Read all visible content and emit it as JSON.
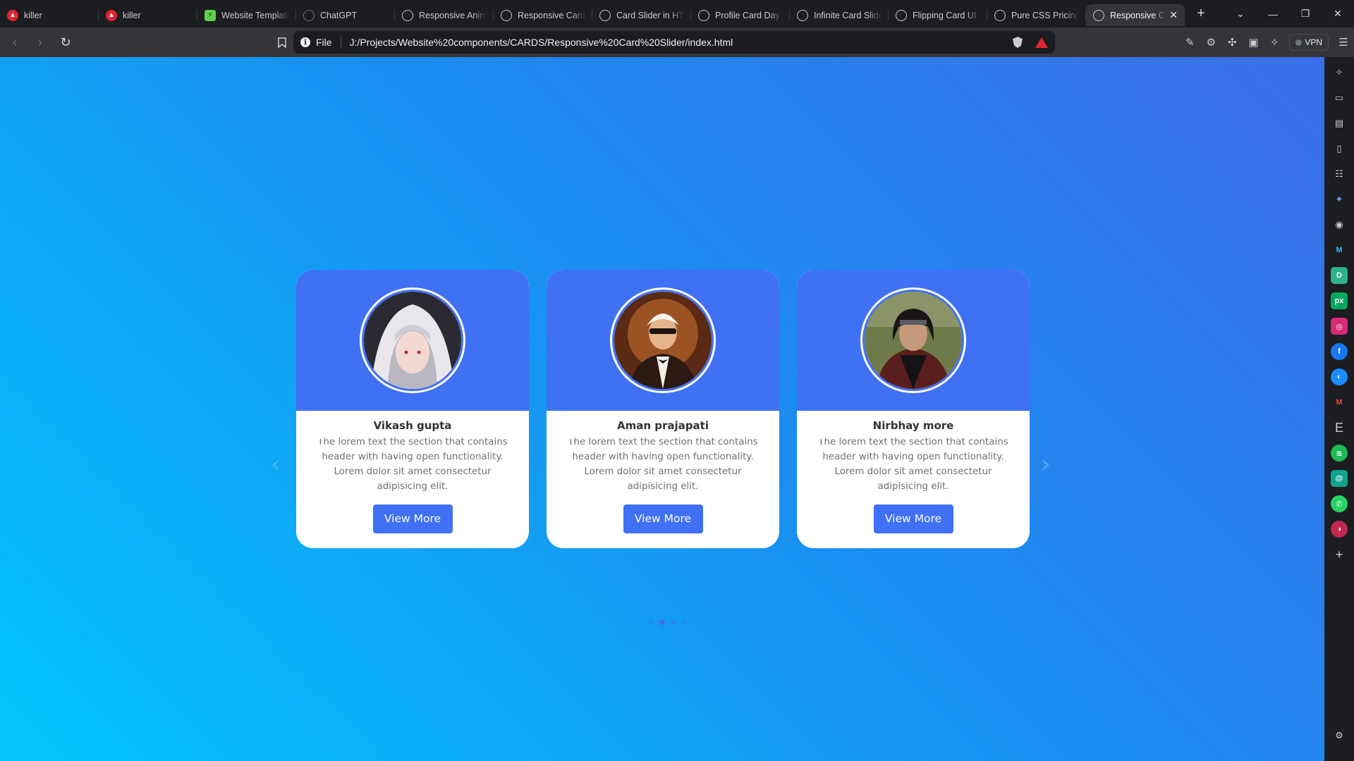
{
  "browser": {
    "tabs": [
      {
        "title": "killer",
        "favicon": "brave-red-icon"
      },
      {
        "title": "killer",
        "favicon": "brave-red-icon"
      },
      {
        "title": "Website Templates",
        "favicon": "green-square-icon"
      },
      {
        "title": "ChatGPT",
        "favicon": "chatgpt-icon"
      },
      {
        "title": "Responsive Animation",
        "favicon": "globe-icon"
      },
      {
        "title": "Responsive Card",
        "favicon": "globe-icon"
      },
      {
        "title": "Card Slider in HTML",
        "favicon": "globe-icon"
      },
      {
        "title": "Profile Card Day",
        "favicon": "globe-icon"
      },
      {
        "title": "Infinite Card Slider",
        "favicon": "globe-icon"
      },
      {
        "title": "Flipping Card UI",
        "favicon": "globe-icon"
      },
      {
        "title": "Pure CSS Pricing",
        "favicon": "globe-icon"
      },
      {
        "title": "Responsive Card Slider",
        "favicon": "globe-icon",
        "active": true
      }
    ],
    "close_glyph": "✕",
    "new_tab_glyph": "+",
    "address": {
      "scheme_label": "File",
      "url": "J:/Projects/Website%20components/CARDS/Responsive%20Card%20Slider/index.html"
    },
    "vpn_label": "VPN"
  },
  "page": {
    "cards": [
      {
        "name": "Vikash gupta",
        "description": "The lorem text the section that contains header with having open functionality. Lorem dolor sit amet consectetur adipisicing elit.",
        "button": "View More"
      },
      {
        "name": "Aman prajapati",
        "description": "The lorem text the section that contains header with having open functionality. Lorem dolor sit amet consectetur adipisicing elit.",
        "button": "View More"
      },
      {
        "name": "Nirbhay more",
        "description": "The lorem text the section that contains header with having open functionality. Lorem dolor sit amet consectetur adipisicing elit.",
        "button": "View More"
      }
    ],
    "prev_arrow": "‹",
    "next_arrow": "›",
    "pagination": {
      "count": 4,
      "active_index": 1
    }
  },
  "colors": {
    "accent": "#4070f4",
    "page_gradient_start": "#02c5fd",
    "page_gradient_end": "#3d6de9"
  }
}
